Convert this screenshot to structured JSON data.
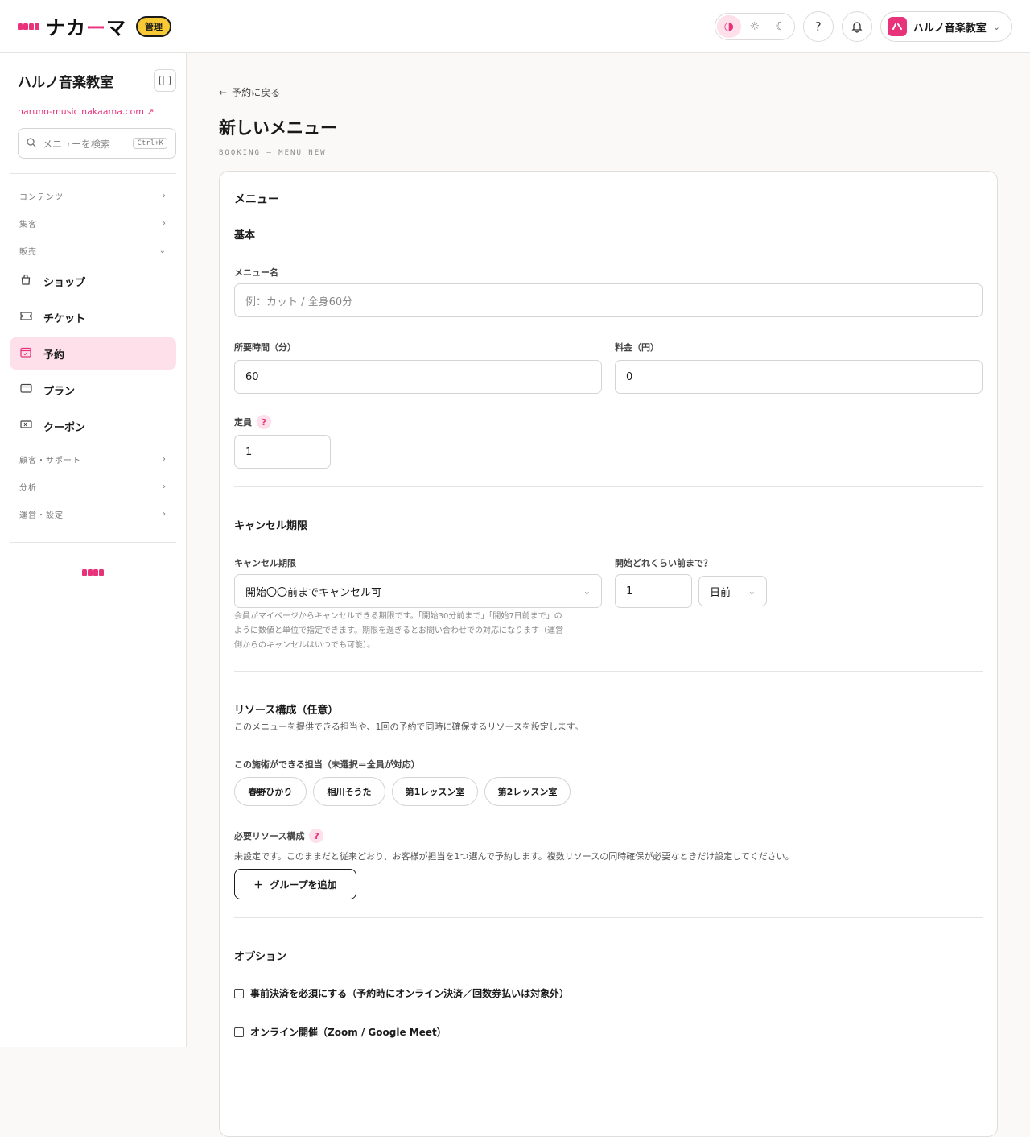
{
  "brand": {
    "name_pre": "ナカ",
    "name_dash": "ー",
    "name_post": "マ",
    "badge": "管理",
    "accent": "#e8337a"
  },
  "header": {
    "account_name": "ハルノ音楽教室",
    "account_initial": "ハ"
  },
  "sidebar": {
    "title": "ハルノ音楽教室",
    "site_link": "haruno-music.nakaama.com",
    "search_placeholder": "メニューを検索",
    "search_shortcut": "Ctrl+K",
    "groups": [
      {
        "label": "コンテンツ"
      },
      {
        "label": "集客"
      },
      {
        "label": "販売"
      }
    ],
    "items": [
      {
        "label": "ショップ",
        "icon": "bag-icon"
      },
      {
        "label": "チケット",
        "icon": "ticket-icon"
      },
      {
        "label": "予約",
        "icon": "calendar-icon",
        "active": true
      },
      {
        "label": "プラン",
        "icon": "card-icon"
      },
      {
        "label": "クーポン",
        "icon": "coupon-icon"
      }
    ],
    "groups_after": [
      {
        "label": "顧客・サポート"
      },
      {
        "label": "分析"
      },
      {
        "label": "運営・設定"
      }
    ]
  },
  "main": {
    "back": "予約に戻る",
    "title": "新しいメニュー",
    "subtitle": "BOOKING — MENU NEW",
    "card_title": "メニュー",
    "basic": {
      "heading": "基本",
      "name_label": "メニュー名",
      "name_placeholder": "例：カット / 全身60分",
      "duration_label": "所要時間（分）",
      "duration_value": "60",
      "price_label": "料金（円）",
      "price_value": "0",
      "capacity_label": "定員",
      "capacity_value": "1"
    },
    "cancel": {
      "heading": "キャンセル期限",
      "deadline_label": "キャンセル期限",
      "deadline_value": "開始〇〇前までキャンセル可",
      "before_label": "開始どれくらい前まで？",
      "before_value": "1",
      "unit_value": "日前",
      "note_1": "会員がマイページからキャンセルできる期限です。「開始30分前まで」「開始7日前まで」の",
      "note_2": "ように数値と単位で指定できます。期限を過ぎるとお問い合わせでの対応になります（運営",
      "note_3": "側からのキャンセルはいつでも可能）。"
    },
    "resources": {
      "heading": "リソース構成（任意）",
      "desc": "このメニューを提供できる担当や、1回の予約で同時に確保するリソースを設定します。",
      "staff_label": "この施術ができる担当（未選択＝全員が対応）",
      "staff": [
        "春野ひかり",
        "相川そうた",
        "第1レッスン室",
        "第2レッスン室"
      ],
      "required_label": "必要リソース構成",
      "required_note": "未設定です。このままだと従来どおり、お客様が担当を1つ選んで予約します。複数リソースの同時確保が必要なときだけ設定してください。",
      "add_group": "グループを追加"
    },
    "options": {
      "heading": "オプション",
      "items": [
        "事前決済を必須にする（予約時にオンライン決済／回数券払いは対象外）",
        "オンライン開催（Zoom / Google Meet）"
      ]
    }
  }
}
